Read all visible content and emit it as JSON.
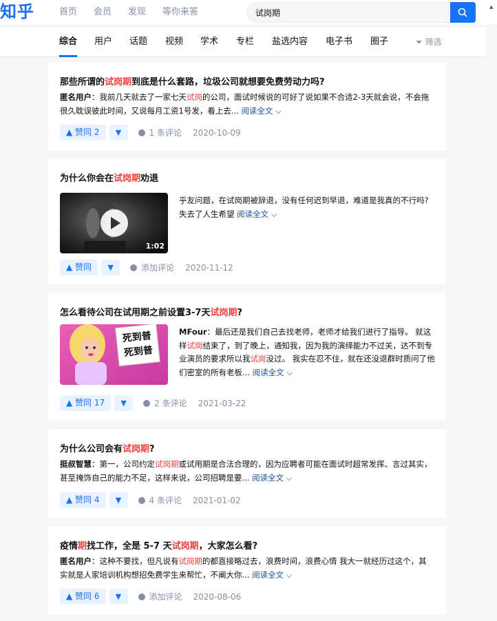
{
  "header": {
    "logo": "知乎",
    "nav": [
      "首页",
      "会员",
      "发现",
      "等你来答"
    ],
    "search_value": "试岗期"
  },
  "tabs": {
    "items": [
      "综合",
      "用户",
      "话题",
      "视频",
      "学术",
      "专栏",
      "盐选内容",
      "电子书",
      "圈子"
    ],
    "active": "综合",
    "filter_label": "筛选"
  },
  "results": [
    {
      "title_pre": "那些所谓的",
      "title_hl": "试岗期",
      "title_post": "到底是什么套路，垃圾公司就想要免费劳动力吗?",
      "author": "匿名用户",
      "excerpt_pre": "：我前几天就去了一家七天",
      "excerpt_hl": "试岗",
      "excerpt_post": "的公司，面试时候说的可好了说如果不合适2-3天就会说，不会拖很久耽误彼此时间，又说每月工资1号发，看上去...",
      "readmore": "阅读全文",
      "vote": "▲ 赞同 2",
      "comment": "1 条评论",
      "date": "2020-10-09"
    },
    {
      "title_pre": "为什么你会在",
      "title_hl": "试岗期",
      "title_post": "劝退",
      "excerpt": "乎友问题，在试岗期被辞退，没有任何迟到早退，难道是我真的不行吗? 失去了人生希望",
      "readmore": "阅读全文",
      "video_duration": "1:02",
      "vote": "▲ 赞同",
      "comment": "添加评论",
      "date": "2020-11-12"
    },
    {
      "title_pre": "怎么看待公司在试用期之前设置3-7天",
      "title_hl": "试岗期",
      "title_post": "?",
      "author": "MFour",
      "excerpt_a": "：最后还是我们自己去找老师，老师才给我们进行了指导。 就这样",
      "hl_1": "试岗",
      "excerpt_b": "结束了，到了晚上，通知我，因为我的演绎能力不过关，达不到专业演员的要求所以我",
      "hl_2": "试岗",
      "excerpt_c": "没过。 我实在忍不住，就在还没退群时质问了他们密室的所有老板...",
      "readmore": "阅读全文",
      "image_sign_text": "死到普\n死到普",
      "vote": "▲ 赞同 17",
      "comment": "2 条评论",
      "date": "2021-03-22"
    },
    {
      "title_pre": "为什么公司会有",
      "title_hl": "试岗期",
      "title_post": "?",
      "author": "挺叔智慧",
      "excerpt_pre": "：第一，公司约定",
      "excerpt_hl": "试岗期",
      "excerpt_post": "或试用期是合法合理的，因为应聘者可能在面试时超常发挥、言过其实，甚至掩饰自己的能力不足，这样来说，公司招聘是要...",
      "readmore": "阅读全文",
      "vote": "▲ 赞同 4",
      "comment": "4 条评论",
      "date": "2021-01-02"
    },
    {
      "title_a": "疫情",
      "title_hl1": "期",
      "title_b": "找工作，全是 5-7 天",
      "title_hl2": "试岗期",
      "title_c": "，大家怎么看?",
      "author": "匿名用户",
      "excerpt_pre": "：这种不要找，但凡说有",
      "excerpt_hl": "试岗期",
      "excerpt_post": "的都直接略过去，浪费时间，浪费心情 我大一就经历过这个，其实就是人家培训机构想招免费学生来帮忙，不阐大你...",
      "readmore": "阅读全文",
      "vote": "▲ 赞同 6",
      "comment": "添加评论",
      "date": "2020-08-06"
    }
  ],
  "colors": {
    "brand": "#1772f6",
    "highlight": "#f1403c",
    "meta": "#8590a6",
    "link": "#175199"
  }
}
